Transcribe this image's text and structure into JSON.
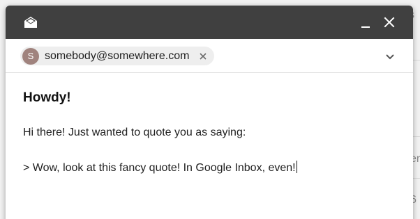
{
  "background": {
    "peek_texts": [
      "s",
      "er",
      "6"
    ]
  },
  "compose": {
    "header": {
      "app_icon": "open-envelope-icon",
      "minimize_icon": "minimize-icon",
      "close_icon": "close-icon"
    },
    "to": {
      "avatar_letter": "S",
      "email": "somebody@somewhere.com",
      "remove_icon": "close-icon",
      "expand_icon": "chevron-down-icon"
    },
    "subject": "Howdy!",
    "body_lines": [
      "Hi there! Just wanted to quote you as saying:",
      "> Wow, look at this fancy quote! In Google Inbox, even!"
    ]
  },
  "colors": {
    "header_bg": "#404040",
    "avatar_bg": "#a0837e",
    "chip_bg": "#eeeeee"
  }
}
